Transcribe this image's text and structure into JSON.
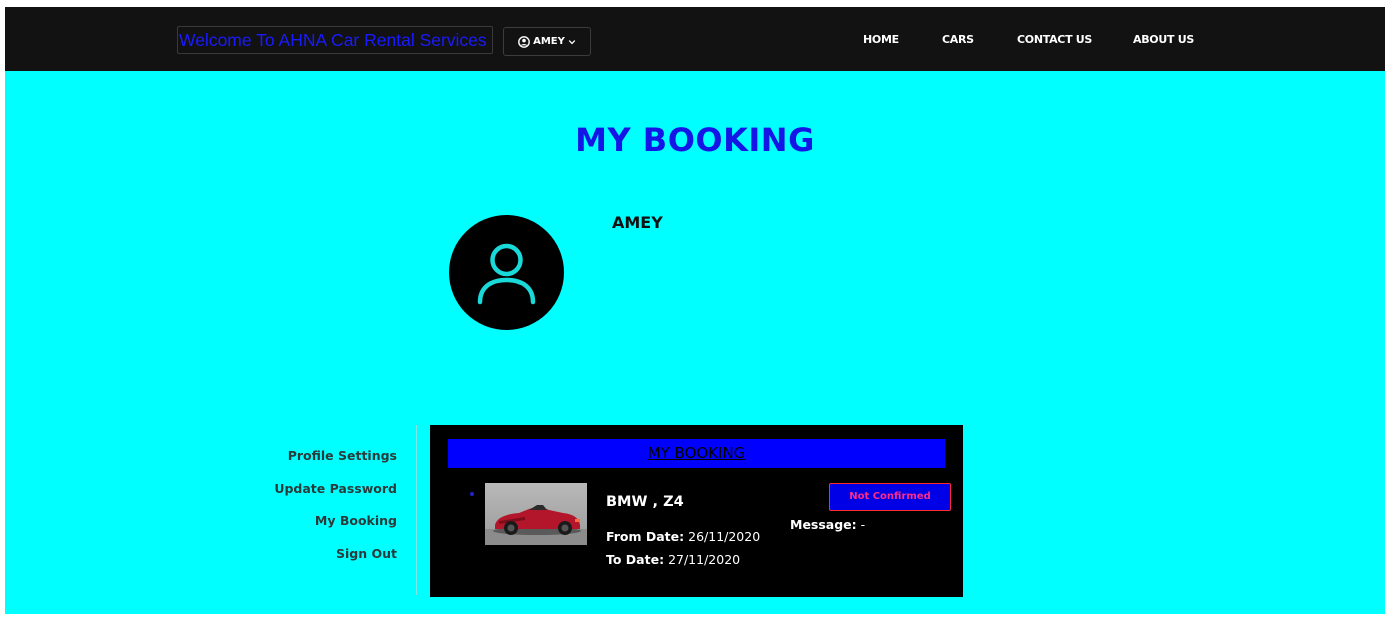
{
  "navbar": {
    "brand": "Welcome To AHNA Car Rental Services",
    "user_label": "AMEY",
    "links": [
      "HOME",
      "CARS",
      "CONTACT US",
      "ABOUT US"
    ]
  },
  "page_title": "MY BOOKING",
  "profile": {
    "name": "AMEY"
  },
  "sidebar": {
    "items": [
      "Profile Settings",
      "Update Password",
      "My Booking",
      "Sign Out"
    ]
  },
  "booking_panel": {
    "header": "MY BOOKING",
    "booking": {
      "car": "BMW , Z4",
      "from_label": "From Date:",
      "from_date": "26/11/2020",
      "to_label": "To Date:",
      "to_date": "27/11/2020",
      "status": "Not Confirmed",
      "message_label": "Message:",
      "message": "-"
    }
  },
  "colors": {
    "background": "#00ffff",
    "navbar": "#121212",
    "title": "#1515e6",
    "panel_header": "#0000ff",
    "status_text": "#ff2a8a"
  },
  "icons": [
    "user-circle-icon",
    "chevron-down-icon",
    "user-avatar-icon"
  ]
}
